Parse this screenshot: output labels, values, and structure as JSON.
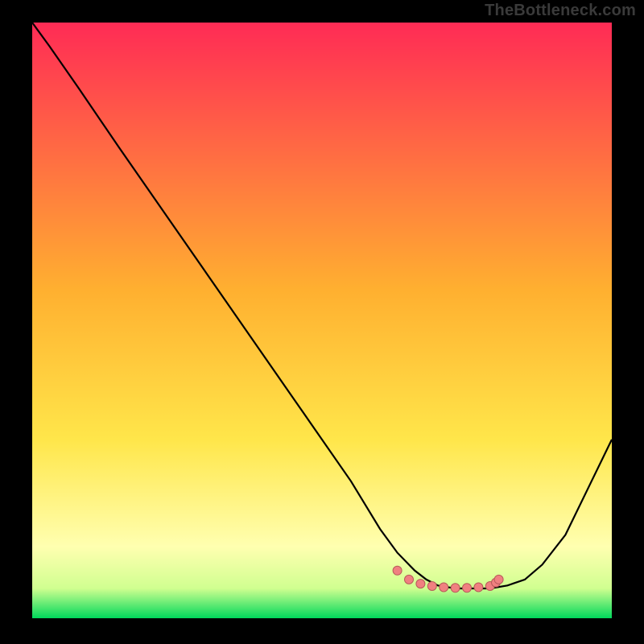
{
  "brand_text": "TheBottleneck.com",
  "colors": {
    "black": "#000000",
    "gradient_top": "#ff2b55",
    "gradient_mid": "#ffd533",
    "gradient_low": "#ffffa0",
    "gradient_green": "#00e05b",
    "line": "#000000",
    "dot_fill": "#f08080",
    "dot_stroke": "#b85a5a"
  },
  "chart_data": {
    "type": "line",
    "title": "",
    "xlabel": "",
    "ylabel": "",
    "xlim": [
      0,
      100
    ],
    "ylim": [
      0,
      100
    ],
    "grid": false,
    "series": [
      {
        "name": "curve",
        "x": [
          0,
          3,
          8,
          15,
          25,
          35,
          45,
          55,
          60,
          63,
          66,
          68,
          70,
          73,
          76,
          79,
          82,
          85,
          88,
          92,
          96,
          100
        ],
        "y": [
          100,
          96,
          89,
          79,
          65,
          51,
          37,
          23,
          15,
          11,
          8,
          6.5,
          5.5,
          5,
          5,
          5,
          5.5,
          6.5,
          9,
          14,
          22,
          30
        ]
      }
    ],
    "scatter_points": {
      "x": [
        63,
        65,
        67,
        69,
        71,
        73,
        75,
        77,
        79,
        80,
        80.5
      ],
      "y": [
        8,
        6.5,
        5.8,
        5.4,
        5.2,
        5.1,
        5.1,
        5.2,
        5.4,
        6,
        6.5
      ]
    },
    "annotations": []
  }
}
